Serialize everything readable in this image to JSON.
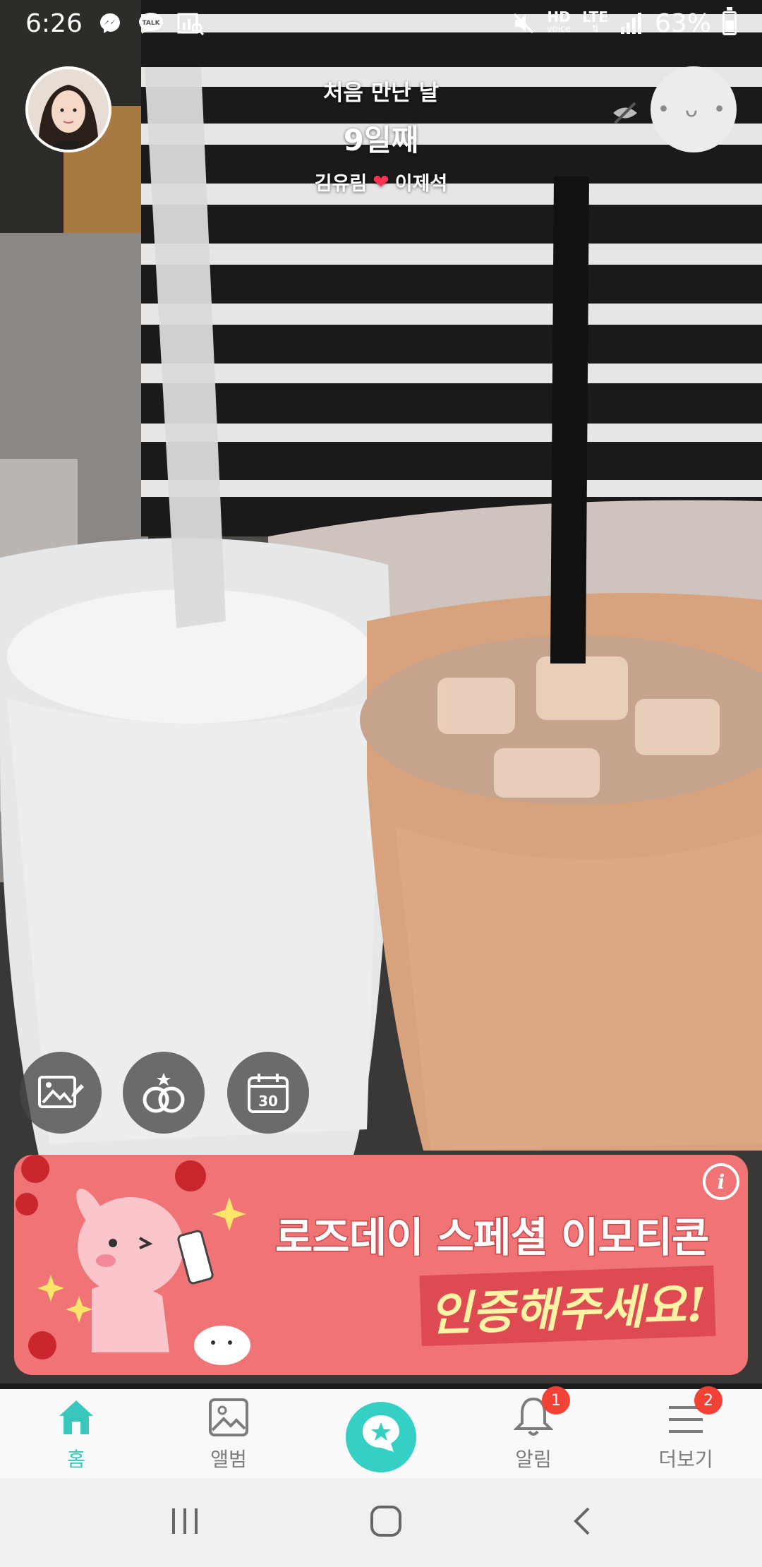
{
  "status_bar": {
    "time": "6:26",
    "hd_label": "HD",
    "voice_label": "voice",
    "network": "LTE",
    "battery_percent": "63%",
    "talk_label": "TALK"
  },
  "header": {
    "anniversary_label": "처음 만난 날",
    "day_count": "9일째",
    "name_left": "김유림",
    "heart": "❤",
    "name_right": "이제석",
    "right_avatar_face": "• ᴗ •"
  },
  "fab_buttons": {
    "calendar_day": "30"
  },
  "banner": {
    "title": "로즈데이 스페셜 이모티콘",
    "subtitle": "인증해주세요!",
    "info_label": "i"
  },
  "bottom_nav": {
    "items": [
      {
        "label": "홈"
      },
      {
        "label": "앨범"
      },
      {
        "label": ""
      },
      {
        "label": "알림",
        "badge": "1"
      },
      {
        "label": "더보기",
        "badge": "2"
      }
    ]
  },
  "colors": {
    "accent": "#36cfc5",
    "banner_bg": "#f07375",
    "badge": "#f24236"
  }
}
